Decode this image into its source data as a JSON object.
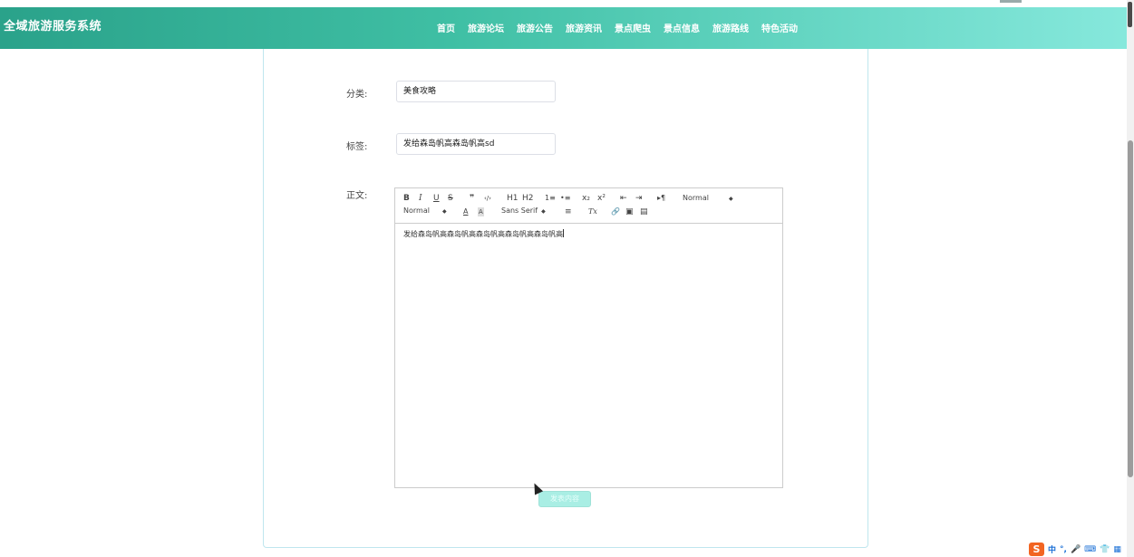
{
  "header": {
    "brand": "全域旅游服务系统",
    "nav": [
      "首页",
      "旅游论坛",
      "旅游公告",
      "旅游资讯",
      "景点爬虫",
      "景点信息",
      "旅游路线",
      "特色活动"
    ]
  },
  "form": {
    "category_label": "分类:",
    "category_value": "美食攻略",
    "tag_label": "标签:",
    "tag_value": "发给森岛帆高森岛帆高sd",
    "content_label": "正文:",
    "content_text": "发给森岛帆高森岛帆高森岛帆高森岛帆高森岛帆高",
    "submit_label": "发表内容"
  },
  "toolbar": {
    "bold": "B",
    "italic": "I",
    "underline": "U",
    "strike": "S",
    "blockquote": "❞",
    "code": "‹/›",
    "h1": "H1",
    "h2": "H2",
    "ordered_list": "1≡",
    "bullet_list": "•≡",
    "subscript": "x₂",
    "superscript": "x²",
    "outdent": "⇤",
    "indent": "⇥",
    "direction": "▸¶",
    "header_picker": "Normal",
    "size_picker": "Normal",
    "font_color": "A",
    "background_color": "A",
    "font_picker": "Sans Serif",
    "align": "≡",
    "clean": "Tx",
    "link": "🔗",
    "image": "▣",
    "video": "▤"
  },
  "tray": {
    "ime": "S",
    "lang": "中",
    "punct": "°,",
    "mic": "🎤",
    "keyboard": "⌨",
    "skin": "👕",
    "menu": "▦"
  }
}
